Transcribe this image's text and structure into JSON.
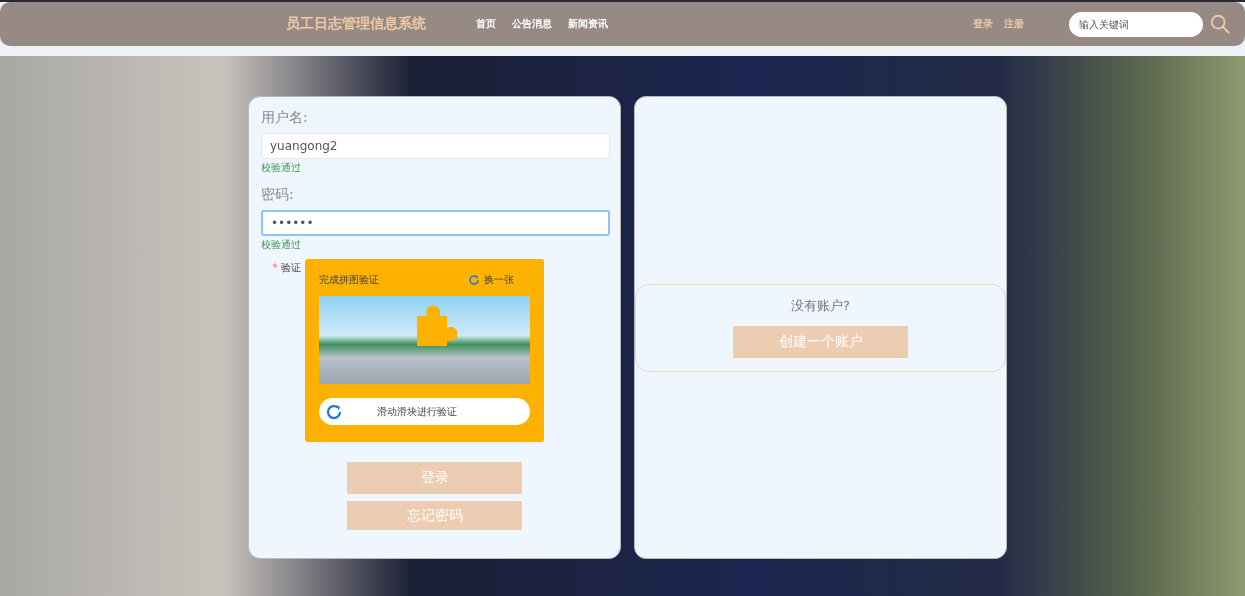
{
  "header": {
    "title": "员工日志管理信息系统",
    "nav": [
      {
        "label": "首页"
      },
      {
        "label": "公告消息"
      },
      {
        "label": "新闻资讯"
      }
    ],
    "auth_links": [
      {
        "label": "登录"
      },
      {
        "label": "注册"
      }
    ],
    "search": {
      "placeholder": "输入关键词"
    }
  },
  "login_form": {
    "fields": [
      {
        "label": "用户名:",
        "value": "yuangong2",
        "focused": false,
        "validation": "校验通过"
      },
      {
        "label": "密码:",
        "value": "••••••",
        "focused": true,
        "validation": "校验通过"
      }
    ],
    "captcha": {
      "label": "验证",
      "required_mark": "*",
      "title": "完成拼图验证",
      "refresh": "换一张",
      "slider_hint": "滑动滑块进行验证"
    },
    "buttons": [
      {
        "label": "登录"
      },
      {
        "label": "忘记密码"
      }
    ]
  },
  "register_panel": {
    "prompt": "没有账户?",
    "button": "创建一个账户"
  }
}
